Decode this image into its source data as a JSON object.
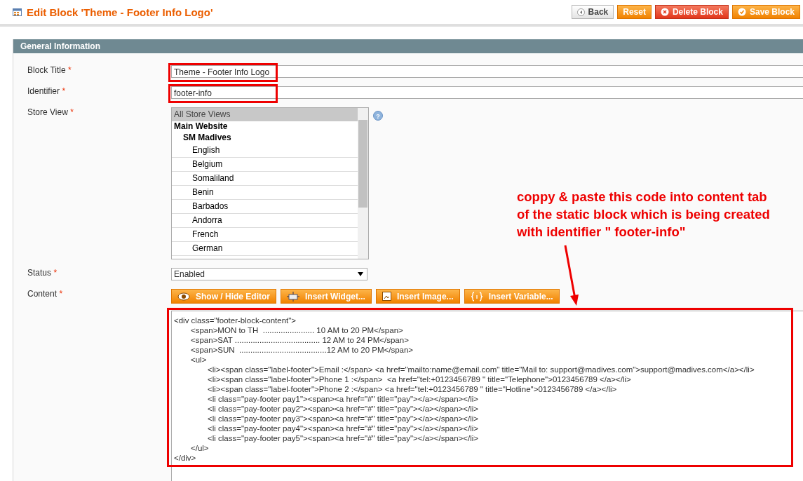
{
  "header": {
    "title": "Edit Block 'Theme - Footer Info Logo'",
    "buttons": [
      {
        "label": "Back",
        "kind": "back"
      },
      {
        "label": "Reset",
        "kind": "plain"
      },
      {
        "label": "Delete Block",
        "kind": "delete"
      },
      {
        "label": "Save Block",
        "kind": "save"
      }
    ]
  },
  "section": {
    "title": "General Information"
  },
  "required_mark": "*",
  "help": "?",
  "fields": {
    "block_title": {
      "label": "Block Title",
      "value": "Theme - Footer Info Logo",
      "highlighted": true
    },
    "identifier": {
      "label": "Identifier",
      "value": "footer-info",
      "highlighted": true
    },
    "store_view": {
      "label": "Store View",
      "options": [
        {
          "label": "All Store Views",
          "kind": "option",
          "selected": true
        },
        {
          "label": "Main Website",
          "kind": "group",
          "children": [
            {
              "label": "SM Madives",
              "kind": "group",
              "children": [
                {
                  "label": "English",
                  "kind": "option",
                  "selected": false
                },
                {
                  "label": "Belgium",
                  "kind": "option",
                  "selected": false
                },
                {
                  "label": "Somaliland",
                  "kind": "option",
                  "selected": false
                },
                {
                  "label": "Benin",
                  "kind": "option",
                  "selected": false
                },
                {
                  "label": "Barbados",
                  "kind": "option",
                  "selected": false
                },
                {
                  "label": "Andorra",
                  "kind": "option",
                  "selected": false
                },
                {
                  "label": "French",
                  "kind": "option",
                  "selected": false
                },
                {
                  "label": "German",
                  "kind": "option",
                  "selected": false
                }
              ]
            }
          ]
        }
      ]
    },
    "status": {
      "label": "Status",
      "value": "Enabled"
    },
    "content": {
      "label": "Content",
      "buttons": [
        {
          "label": "Show / Hide Editor",
          "kind": "eye"
        },
        {
          "label": "Insert Widget...",
          "kind": "widget"
        },
        {
          "label": "Insert Image...",
          "kind": "image"
        },
        {
          "label": "Insert Variable...",
          "kind": "variable"
        }
      ],
      "highlighted": true,
      "lines": [
        {
          "text": "<div class=\"footer-block-content\">",
          "children": [
            {
              "text": "<span>MON to TH  ....................... 10 AM to 20 PM</span>"
            },
            {
              "text": "<span>SAT ...................................... 12 AM to 24 PM</span>"
            },
            {
              "text": "<span>SUN  .......................................12 AM to 20 PM</span>"
            },
            {
              "text": "<ul>",
              "children": [
                {
                  "text": "<li><span class=\"label-footer\">Email :</span> <a href=\"mailto:name@email.com\" title=\"Mail to: support@madives.com\">support@madives.com</a></li>"
                },
                {
                  "text": "<li><span class=\"label-footer\">Phone 1 :</span>  <a href=\"tel:+0123456789 \" title=\"Telephone\">0123456789 </a></li>"
                },
                {
                  "text": "<li><span class=\"label-footer\">Phone 2 :</span> <a href=\"tel:+0123456789 \" title=\"Hotline\">0123456789 </a></li>"
                },
                {
                  "text": "<li class=\"pay-footer pay1\"><span><a href=\"#\" title=\"pay\"></a></span></li>"
                },
                {
                  "text": "<li class=\"pay-footer pay2\"><span><a href=\"#\" title=\"pay\"></a></span></li>"
                },
                {
                  "text": "<li class=\"pay-footer pay3\"><span><a href=\"#\" title=\"pay\"></a></span></li>"
                },
                {
                  "text": "<li class=\"pay-footer pay4\"><span><a href=\"#\" title=\"pay\"></a></span></li>"
                },
                {
                  "text": "<li class=\"pay-footer pay5\"><span><a href=\"#\" title=\"pay\"></a></span></li>"
                }
              ]
            },
            {
              "text": "</ul>"
            }
          ]
        },
        {
          "text": "</div>"
        }
      ]
    }
  },
  "annotation": {
    "text": "coppy & paste this code into content tab of the static block which is being created with identifier \" footer-info\""
  }
}
